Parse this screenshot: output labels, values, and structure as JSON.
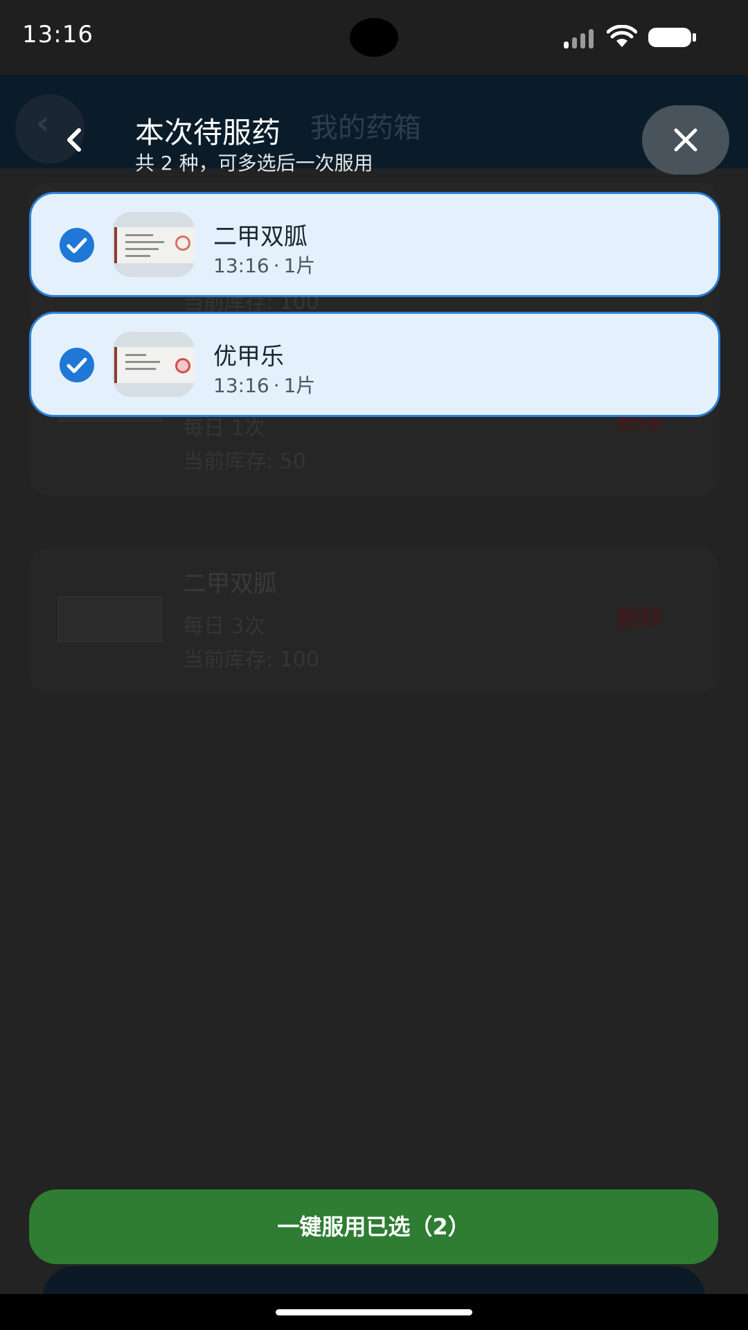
{
  "status_bar": {
    "time": "13:16"
  },
  "background": {
    "title": "我的药箱",
    "cards": [
      {
        "name": "",
        "frequency": "",
        "stock": "当前库存: 100",
        "delete": ""
      },
      {
        "name": "",
        "frequency": "每日 1次",
        "stock": "当前库存: 50",
        "delete": "删除"
      },
      {
        "name": "二甲双胍",
        "frequency": "每日 3次",
        "stock": "当前库存: 100",
        "delete": "删除"
      }
    ]
  },
  "sheet": {
    "title": "本次待服药",
    "subtitle": "共 2 种，可多选后一次服用",
    "items": [
      {
        "name": "二甲双胍",
        "time": "13:16",
        "dose": "1片",
        "separator": "·",
        "selected": true
      },
      {
        "name": "优甲乐",
        "time": "13:16",
        "dose": "1片",
        "separator": "·",
        "selected": true
      }
    ],
    "primary_button": "一键服用已选（2）"
  },
  "colors": {
    "accent": "#2b7fd6",
    "item_bg": "#e4f1fd",
    "button_green": "#2e7d32",
    "delete_red": "#4a1515"
  },
  "icons": {
    "back": "chevron-left-icon",
    "close": "close-icon",
    "check": "check-circle-icon"
  }
}
